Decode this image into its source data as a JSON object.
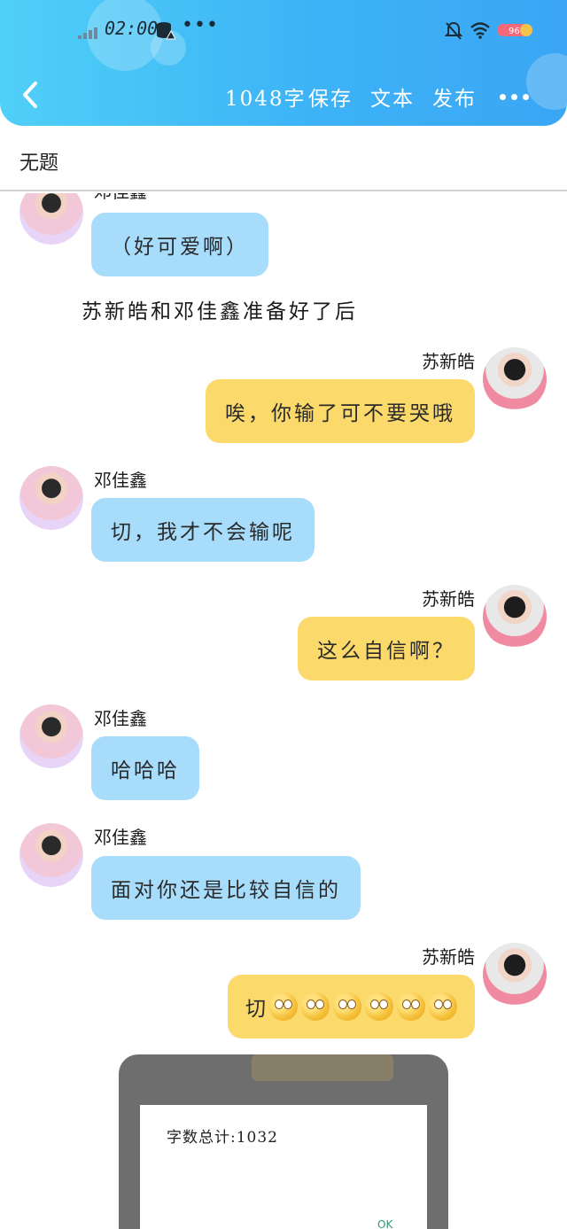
{
  "status_bar": {
    "time": "02:00",
    "overflow_dots": "•••",
    "battery_level": "96",
    "icons": [
      "signal-icon",
      "database-icon",
      "bell-off-icon",
      "wifi-icon",
      "battery-icon"
    ]
  },
  "toolbar": {
    "word_count": "1048字",
    "save_label": "保存",
    "text_label": "文本",
    "publish_label": "发布",
    "more_label": "•••",
    "back_icon": "back-chevron-icon"
  },
  "document": {
    "title": "无题"
  },
  "messages": [
    {
      "side": "left",
      "name": "邓佳鑫",
      "text": "（好可爱啊）"
    },
    {
      "type": "narration",
      "text": "苏新皓和邓佳鑫准备好了后"
    },
    {
      "side": "right",
      "name": "苏新皓",
      "text": "唉，你输了可不要哭哦"
    },
    {
      "side": "left",
      "name": "邓佳鑫",
      "text": "切，我才不会输呢"
    },
    {
      "side": "right",
      "name": "苏新皓",
      "text": "这么自信啊？"
    },
    {
      "side": "left",
      "name": "邓佳鑫",
      "text": "哈哈哈"
    },
    {
      "side": "left",
      "name": "邓佳鑫",
      "text": "面对你还是比较自信的"
    },
    {
      "side": "right",
      "name": "苏新皓",
      "text": "切",
      "emoji_count": 6,
      "emoji": "eye-roll-emoji"
    }
  ],
  "dialog": {
    "text": "字数总计:1032",
    "ok_label": "OK"
  },
  "colors": {
    "header_gradient_start": "#4fd0f7",
    "header_gradient_end": "#3aa6f4",
    "left_bubble": "#a8dcfb",
    "right_bubble": "#fbd96a"
  }
}
